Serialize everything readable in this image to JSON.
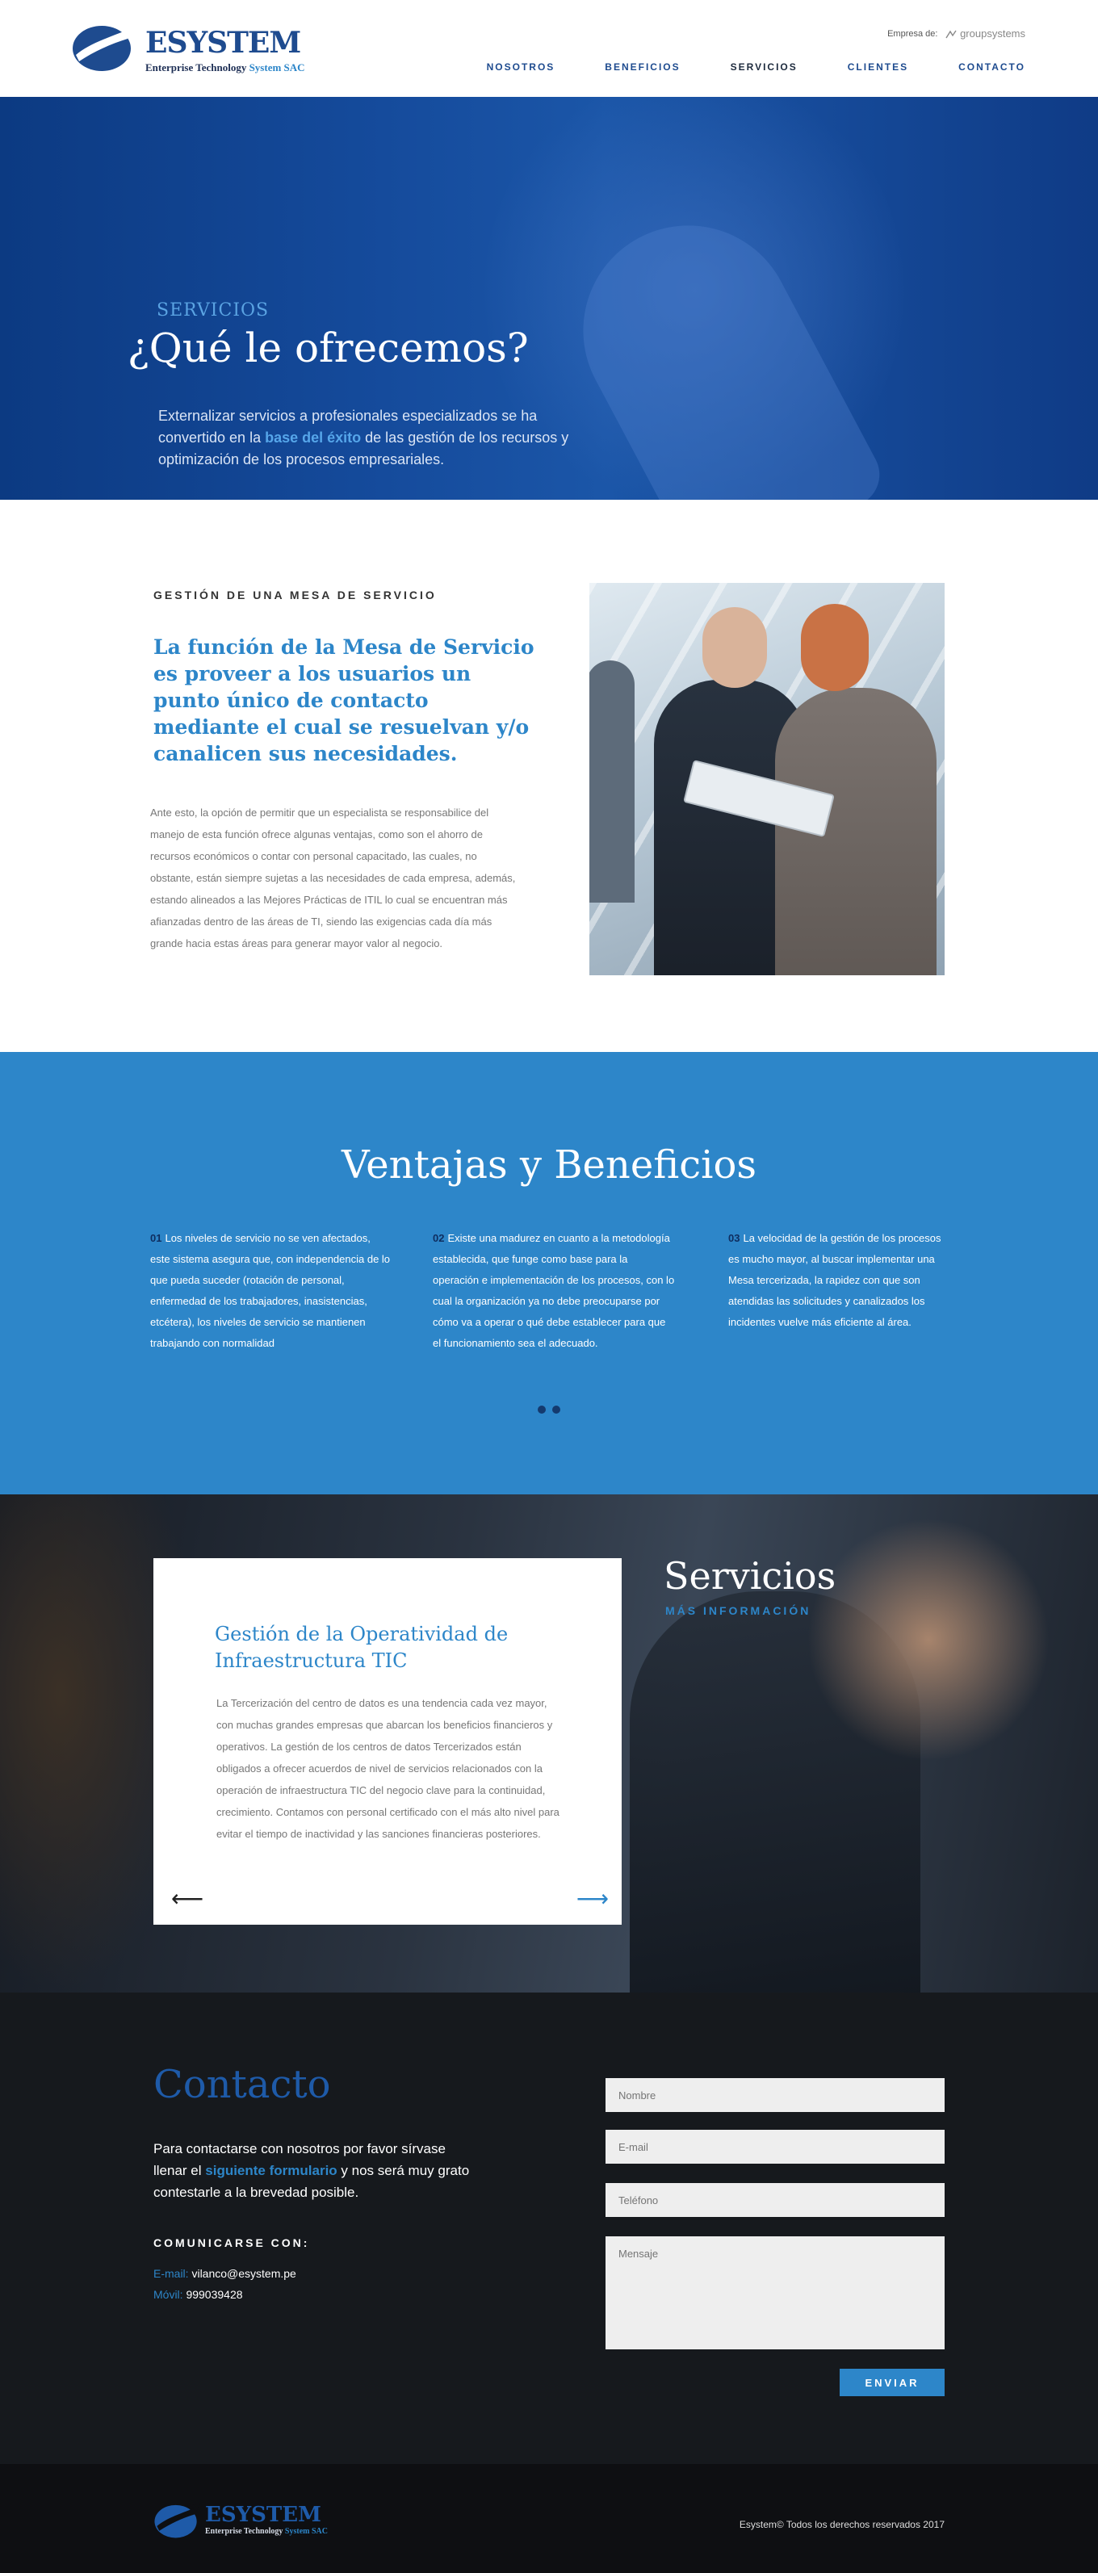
{
  "header": {
    "logo": {
      "brand": "ESYSTEM",
      "tagline_a": "Enterprise Technology",
      "tagline_b": "System SAC"
    },
    "company_label": "Empresa de:",
    "company_name": "groupsystems",
    "nav": [
      "NOSOTROS",
      "BENEFICIOS",
      "SERVICIOS",
      "CLIENTES",
      "CONTACTO"
    ]
  },
  "hero": {
    "kicker": "SERVICIOS",
    "title": "¿Qué le ofrecemos?",
    "intro_a": "Externalizar servicios a profesionales especializados se ha convertido en la ",
    "intro_highlight": "base del éxito",
    "intro_b": " de las gestión de los recursos y optimización de los procesos empresariales."
  },
  "gestion": {
    "eyebrow": "GESTIÓN DE UNA MESA DE SERVICIO",
    "heading": "La función de la Mesa de Servicio es proveer a los usuarios un punto único de contacto mediante el cual se resuelvan y/o canalicen sus necesidades.",
    "body": "Ante esto, la opción de permitir que un especialista se responsabilice del manejo de esta función ofrece algunas ventajas, como son el ahorro de recursos económicos o contar con personal capacitado, las cuales, no obstante, están siempre sujetas a las necesidades de cada empresa, además, estando alineados a las Mejores Prácticas de ITIL lo cual se encuentran más afianzadas dentro de  las áreas de TI, siendo las exigencias cada día más grande hacia estas áreas para generar mayor valor al negocio."
  },
  "ventajas": {
    "title": "Ventajas y Beneficios",
    "items": [
      {
        "num": "01",
        "text": "Los niveles de servicio no se ven afectados, este sistema asegura que, con independencia de lo que pueda suceder (rotación de personal, enfermedad de los trabajadores, inasistencias, etcétera), los niveles de servicio se mantienen trabajando con normalidad"
      },
      {
        "num": "02",
        "text": "Existe una madurez en cuanto a la metodología establecida, que funge como base para la operación e implementación de los procesos, con lo cual la organización ya no debe preocuparse por cómo va a operar o qué debe establecer para que el funcionamiento sea el adecuado."
      },
      {
        "num": "03",
        "text": "La velocidad de la gestión de los procesos es mucho mayor, al buscar implementar una Mesa tercerizada, la rapidez con que son atendidas las solicitudes y canalizados los incidentes vuelve más eficiente al área."
      }
    ]
  },
  "servicios": {
    "card_title": "Gestión de la Operatividad de Infraestructura TIC",
    "card_text": "La Tercerización del centro de datos es una tendencia cada vez mayor, con muchas grandes empresas que abarcan los beneficios financieros y operativos. La gestión de los centros de datos Tercerizados están obligados a ofrecer acuerdos de nivel de servicios relacionados con la operación de infraestructura TIC del negocio clave para la continuidad, crecimiento. Contamos con personal certificado con el más alto nivel para evitar el tiempo de inactividad y las sanciones financieras posteriores.",
    "title": "Servicios",
    "more": "MÁS INFORMACIÓN",
    "prev_icon": "arrow-left-icon",
    "next_icon": "arrow-right-icon"
  },
  "contacto": {
    "title": "Contacto",
    "lead_a": "Para contactarse con nosotros por favor sírvase llenar el ",
    "lead_highlight": "siguiente formulario",
    "lead_b": " y nos será muy grato contestarle a la brevedad posible.",
    "comm_label": "COMUNICARSE CON:",
    "email_label": "E-mail:",
    "email": "vilanco@esystem.pe",
    "movil_label": "Móvil:",
    "movil": "999039428",
    "form": {
      "name_placeholder": "Nombre",
      "email_placeholder": "E-mail",
      "phone_placeholder": "Teléfono",
      "message_placeholder": "Mensaje",
      "send_label": "ENVIAR"
    }
  },
  "footer": {
    "logo": {
      "brand": "ESYSTEM",
      "tagline_a": "Enterprise Technology",
      "tagline_b": "System SAC"
    },
    "copyright": "Esystem© Todos los derechos reservados 2017"
  },
  "colors": {
    "accent": "#2d86c9",
    "brand_dark": "#1e4b8f",
    "hero": "#154b9c",
    "footer": "#0e0f12"
  }
}
